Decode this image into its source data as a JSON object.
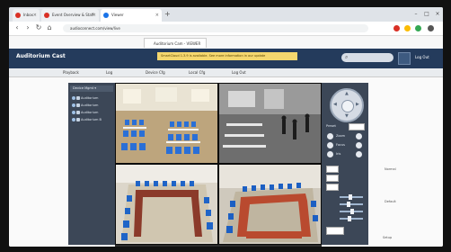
{
  "browser": {
    "tabs": [
      {
        "label": "Inbox",
        "favicon": "#d93025"
      },
      {
        "label": "Event Overview & Staff",
        "favicon": "#d93025"
      },
      {
        "label": "Viewer",
        "favicon": "#1a73e8"
      }
    ],
    "url": "audioconnect.com/view/live",
    "inner_tab": "Auditorium Cam - VIEWER"
  },
  "app": {
    "title": "Auditorium Cast",
    "banner": "SmartCloud 1.3.9 is available. See more information in our update",
    "header_right": "Log Out",
    "menu": [
      "Playback",
      "Log",
      "Device Cfg",
      "Local Cfg",
      "Log Out"
    ]
  },
  "left_panel": {
    "title": "Device Mgmt ▾",
    "devices": [
      "Auditorium",
      "Auditorium",
      "Auditorium",
      "Auditorium B"
    ]
  },
  "right_panel": {
    "labels": [
      "Preset",
      "Zoom",
      "Focus",
      "Iris"
    ],
    "status": [
      "Normal",
      "Default",
      "Setup"
    ]
  },
  "colors": {
    "header": "#243b5c",
    "panel": "#3c4757",
    "banner": "#f5d76e"
  }
}
